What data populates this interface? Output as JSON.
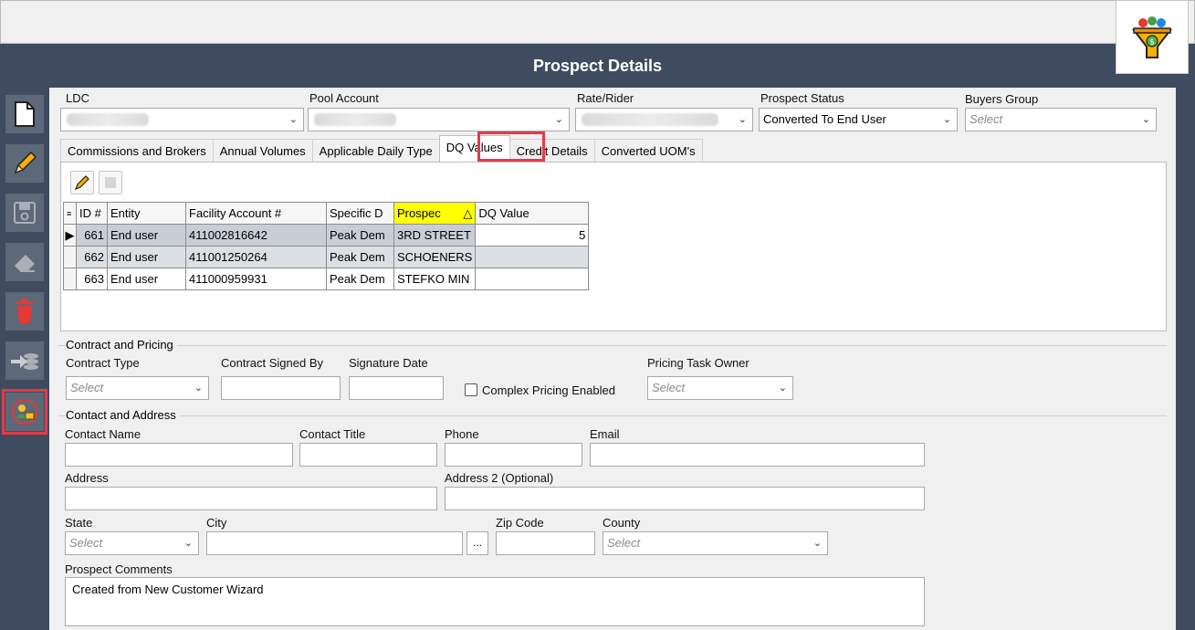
{
  "window": {
    "title": "Prospect Details"
  },
  "colors": {
    "chrome": "#3f4c5f",
    "highlight": "#e63946",
    "sorted_header": "#ffff00"
  },
  "sidebar": {
    "tools": [
      {
        "icon": "new-document-icon"
      },
      {
        "icon": "pencil-edit-icon"
      },
      {
        "icon": "save-disk-icon"
      },
      {
        "icon": "eraser-icon"
      },
      {
        "icon": "trash-icon"
      },
      {
        "icon": "convert-arrow-icon"
      },
      {
        "icon": "prospect-convert-icon"
      }
    ]
  },
  "header_fields": {
    "ldc_label": "LDC",
    "pool_label": "Pool Account",
    "rate_label": "Rate/Rider",
    "status_label": "Prospect Status",
    "status_value": "Converted To End User",
    "buyers_label": "Buyers Group",
    "buyers_placeholder": "Select"
  },
  "tabs": [
    "Commissions and Brokers",
    "Annual Volumes",
    "Applicable Daily Type",
    "DQ Values",
    "Credit Details",
    "Converted UOM's"
  ],
  "grid": {
    "columns": [
      "ID #",
      "Entity",
      "Facility Account #",
      "Specific D",
      "Prospec",
      "DQ Value"
    ],
    "sort_indicator": "△",
    "rows": [
      {
        "id": "661",
        "entity": "End user",
        "facility": "411002816642",
        "specific": "Peak Dem",
        "prospect": "3RD STREET",
        "dq": "5"
      },
      {
        "id": "662",
        "entity": "End user",
        "facility": "411001250264",
        "specific": "Peak Dem",
        "prospect": "SCHOENERS",
        "dq": ""
      },
      {
        "id": "663",
        "entity": "End user",
        "facility": "411000959931",
        "specific": "Peak Dem",
        "prospect": "STEFKO MIN",
        "dq": ""
      }
    ]
  },
  "contract": {
    "section_title": "Contract and Pricing",
    "type_label": "Contract Type",
    "type_placeholder": "Select",
    "signed_by_label": "Contract Signed By",
    "signature_date_label": "Signature Date",
    "complex_label": "Complex Pricing Enabled",
    "owner_label": "Pricing Task Owner",
    "owner_placeholder": "Select"
  },
  "contact": {
    "section_title": "Contact and Address",
    "name_label": "Contact Name",
    "title_label": "Contact Title",
    "phone_label": "Phone",
    "email_label": "Email",
    "address_label": "Address",
    "address2_label": "Address 2 (Optional)",
    "state_label": "State",
    "state_placeholder": "Select",
    "city_label": "City",
    "city_button": "...",
    "zip_label": "Zip Code",
    "county_label": "County",
    "county_placeholder": "Select",
    "comments_label": "Prospect Comments",
    "comments_value": "Created from New Customer Wizard"
  }
}
